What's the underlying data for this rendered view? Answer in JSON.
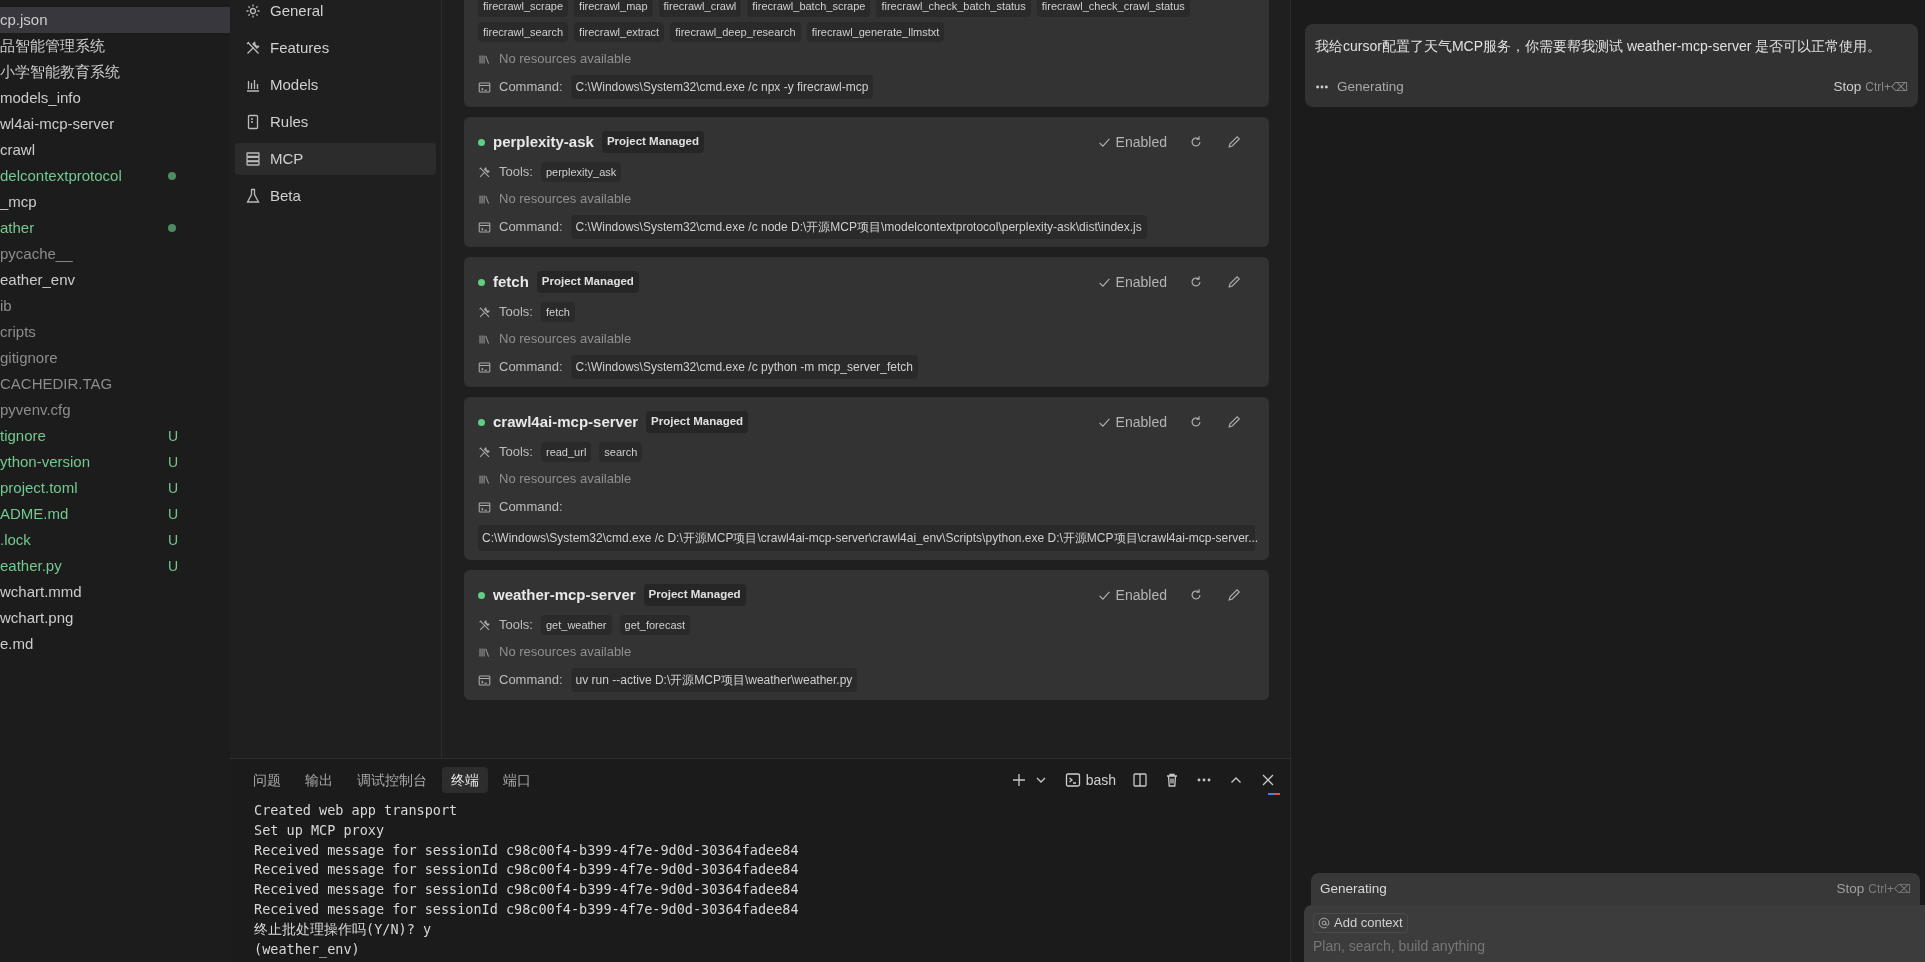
{
  "file_tree": [
    {
      "label": "cp.json",
      "kind": "none",
      "selected": true
    },
    {
      "label": "品智能管理系统",
      "kind": "none",
      "selected": false
    },
    {
      "label": "小学智能教育系统",
      "kind": "none",
      "selected": false
    },
    {
      "label": "models_info",
      "kind": "none",
      "selected": false
    },
    {
      "label": "wl4ai-mcp-server",
      "kind": "none",
      "selected": false
    },
    {
      "label": "crawl",
      "kind": "none",
      "selected": false
    },
    {
      "label": "delcontextprotocol",
      "kind": "modified",
      "selected": false
    },
    {
      "label": "_mcp",
      "kind": "none",
      "selected": false
    },
    {
      "label": "ather",
      "kind": "modified",
      "selected": false
    },
    {
      "label": "pycache__",
      "kind": "ignored",
      "selected": false
    },
    {
      "label": "eather_env",
      "kind": "none",
      "selected": false
    },
    {
      "label": "ib",
      "kind": "ignored",
      "selected": false
    },
    {
      "label": "cripts",
      "kind": "ignored",
      "selected": false
    },
    {
      "label": "gitignore",
      "kind": "ignored",
      "selected": false
    },
    {
      "label": "CACHEDIR.TAG",
      "kind": "ignored",
      "selected": false
    },
    {
      "label": "pyvenv.cfg",
      "kind": "ignored",
      "selected": false
    },
    {
      "label": "tignore",
      "kind": "untracked",
      "badge": "U",
      "selected": false
    },
    {
      "label": "ython-version",
      "kind": "untracked",
      "badge": "U",
      "selected": false
    },
    {
      "label": "project.toml",
      "kind": "untracked",
      "badge": "U",
      "selected": false
    },
    {
      "label": "ADME.md",
      "kind": "untracked",
      "badge": "U",
      "selected": false
    },
    {
      "label": ".lock",
      "kind": "untracked",
      "badge": "U",
      "selected": false
    },
    {
      "label": "eather.py",
      "kind": "untracked",
      "badge": "U",
      "selected": false
    },
    {
      "label": "wchart.mmd",
      "kind": "none",
      "selected": false
    },
    {
      "label": "wchart.png",
      "kind": "none",
      "selected": false
    },
    {
      "label": "e.md",
      "kind": "none",
      "selected": false
    }
  ],
  "settings_nav": [
    {
      "label": "General",
      "selected": false
    },
    {
      "label": "Features",
      "selected": false
    },
    {
      "label": "Models",
      "selected": false
    },
    {
      "label": "Rules",
      "selected": false
    },
    {
      "label": "MCP",
      "selected": true
    },
    {
      "label": "Beta",
      "selected": false
    }
  ],
  "servers": [
    {
      "tools": [
        "firecrawl_scrape",
        "firecrawl_map",
        "firecrawl_crawl",
        "firecrawl_batch_scrape",
        "firecrawl_check_batch_status",
        "firecrawl_check_crawl_status",
        "firecrawl_search",
        "firecrawl_extract",
        "firecrawl_deep_research",
        "firecrawl_generate_llmstxt"
      ],
      "resources": "No resources available",
      "command_label": "Command:",
      "command": "C:\\Windows\\System32\\cmd.exe /c npx -y firecrawl-mcp",
      "command_wrapped": false
    },
    {
      "name": "perplexity-ask",
      "badge": "Project Managed",
      "enabled": true,
      "status": "Enabled",
      "tools_label": "Tools:",
      "tools": [
        "perplexity_ask"
      ],
      "resources": "No resources available",
      "command_label": "Command:",
      "command": "C:\\Windows\\System32\\cmd.exe /c node D:\\开源MCP项目\\modelcontextprotocol\\perplexity-ask\\dist\\index.js",
      "command_wrapped": false
    },
    {
      "name": "fetch",
      "badge": "Project Managed",
      "enabled": true,
      "status": "Enabled",
      "tools_label": "Tools:",
      "tools": [
        "fetch"
      ],
      "resources": "No resources available",
      "command_label": "Command:",
      "command": "C:\\Windows\\System32\\cmd.exe /c python -m mcp_server_fetch",
      "command_wrapped": false
    },
    {
      "name": "crawl4ai-mcp-server",
      "badge": "Project Managed",
      "enabled": true,
      "status": "Enabled",
      "tools_label": "Tools:",
      "tools": [
        "read_url",
        "search"
      ],
      "resources": "No resources available",
      "command_label": "Command:",
      "command": "C:\\Windows\\System32\\cmd.exe /c D:\\开源MCP项目\\crawl4ai-mcp-server\\crawl4ai_env\\Scripts\\python.exe D:\\开源MCP项目\\crawl4ai-mcp-server...",
      "command_wrapped": true
    },
    {
      "name": "weather-mcp-server",
      "badge": "Project Managed",
      "enabled": true,
      "status": "Enabled",
      "tools_label": "Tools:",
      "tools": [
        "get_weather",
        "get_forecast"
      ],
      "resources": "No resources available",
      "command_label": "Command:",
      "command": "uv run --active D:\\开源MCP项目\\weather\\weather.py",
      "command_wrapped": false
    }
  ],
  "terminal": {
    "tabs": [
      {
        "label": "问题",
        "selected": false
      },
      {
        "label": "输出",
        "selected": false
      },
      {
        "label": "调试控制台",
        "selected": false
      },
      {
        "label": "终端",
        "selected": true
      },
      {
        "label": "端口",
        "selected": false
      }
    ],
    "shell": "bash",
    "lines": [
      "Created web app transport",
      "Set up MCP proxy",
      "Received message for sessionId c98c00f4-b399-4f7e-9d0d-30364fadee84",
      "Received message for sessionId c98c00f4-b399-4f7e-9d0d-30364fadee84",
      "Received message for sessionId c98c00f4-b399-4f7e-9d0d-30364fadee84",
      "Received message for sessionId c98c00f4-b399-4f7e-9d0d-30364fadee84",
      "终止批处理操作吗(Y/N)? y",
      "(weather_env)"
    ]
  },
  "chat": {
    "message": "我给cursor配置了天气MCP服务，你需要帮我测试 weather-mcp-server 是否可以正常使用。",
    "status": "Generating",
    "stop": "Stop",
    "shortcut": "Ctrl+⌫",
    "composer": {
      "status": "Generating",
      "stop": "Stop",
      "shortcut": "Ctrl+⌫",
      "add_context": "Add context",
      "placeholder": "Plan, search, build anything"
    }
  }
}
